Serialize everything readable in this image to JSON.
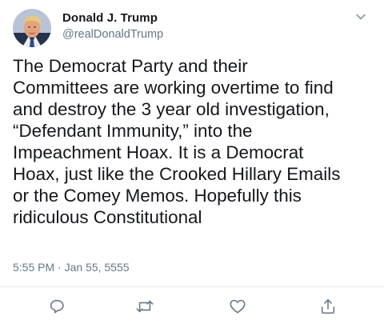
{
  "author": {
    "display_name": "Donald J. Trump",
    "handle": "@realDonaldTrump"
  },
  "tweet": {
    "lines": [
      "The Democrat Party and their",
      "Committees are working overtime to find",
      "and destroy the 3 year old investigation,",
      "“Defendant Immunity,” into the",
      "Impeachment Hoax. It is a Democrat",
      "Hoax, just like the Crooked Hillary Emails",
      "or the Comey Memos. Hopefully this",
      "ridiculous Constitutional"
    ],
    "timestamp": "5:55 PM · Jan 55, 5555"
  },
  "icons": {
    "more": "chevron-down-icon",
    "reply": "reply-icon",
    "retweet": "retweet-icon",
    "like": "heart-icon",
    "share": "share-icon"
  },
  "colors": {
    "text": "#14171a",
    "secondary": "#657786",
    "icon": "#657786",
    "divider": "#e6ecf0"
  }
}
